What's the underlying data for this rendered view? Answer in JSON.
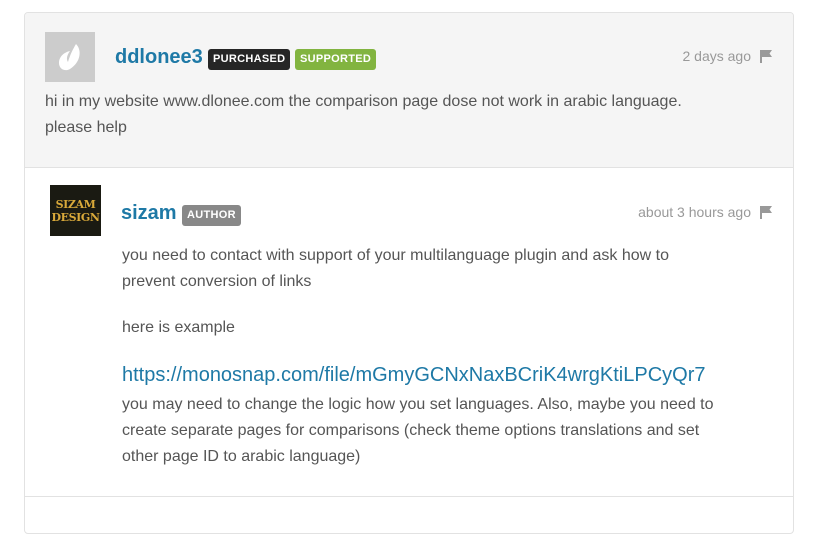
{
  "post": {
    "username": "ddlonee3",
    "badges": [
      "PURCHASED",
      "SUPPORTED"
    ],
    "timestamp": "2 days ago",
    "body_line1": "hi in my website www.dlonee.com the comparison page dose not work in arabic language.",
    "body_line2": "please help"
  },
  "reply": {
    "username": "sizam",
    "badge": "AUTHOR",
    "timestamp": "about 3 hours ago",
    "avatar_text_line1": "SIZAM",
    "avatar_text_line2": "DESIGN",
    "para1_line1": "you need to contact with support of your multilanguage plugin and ask how to",
    "para1_line2": "prevent conversion of links",
    "para2": "here is example",
    "link": "https://monosnap.com/file/mGmyGCNxNaxBCriK4wrgKtiLPCyQr7",
    "para3_line1": "you may need to change the logic how you set languages. Also, maybe you need to",
    "para3_line2": "create separate pages for comparisons (check theme options translations and set",
    "para3_line3": "other page ID to arabic language)"
  },
  "icons": {
    "flag": "flag-icon",
    "default_avatar": "envato-leaf-icon"
  },
  "colors": {
    "username": "#1e79a6",
    "purchased": "#262626",
    "supported": "#82b440",
    "author": "#888888"
  }
}
